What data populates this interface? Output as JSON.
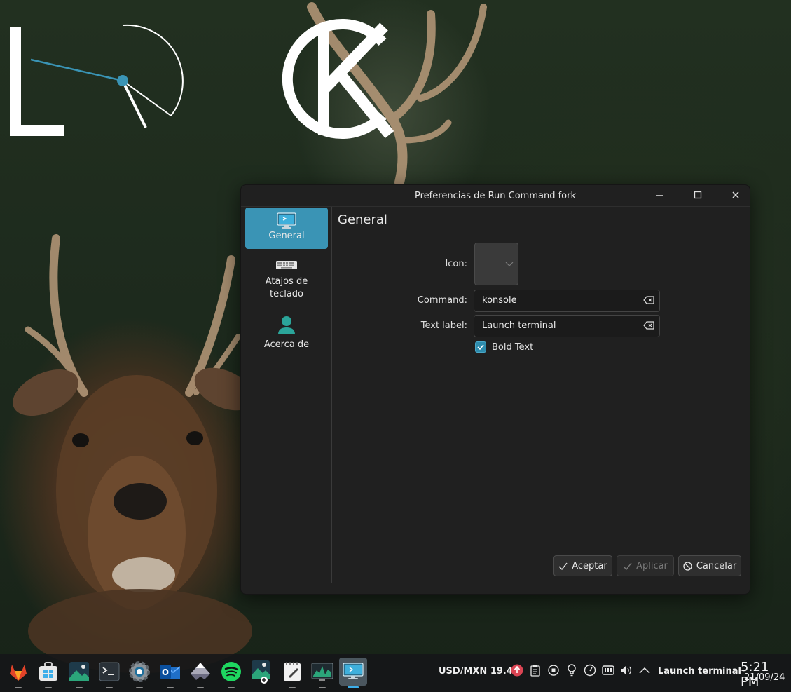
{
  "wallpaper": {
    "widget_text": "LOCK"
  },
  "dialog": {
    "title": "Preferencias de Run Command fork",
    "sidebar": [
      {
        "label": "General",
        "icon": "monitor-icon",
        "active": true
      },
      {
        "label": "Atajos de teclado",
        "icon": "keyboard-icon",
        "active": false
      },
      {
        "label": "Acerca de",
        "icon": "user-icon",
        "active": false
      }
    ],
    "page_title": "General",
    "form": {
      "icon_label": "Icon:",
      "command_label": "Command:",
      "command_value": "konsole",
      "text_label_label": "Text label:",
      "text_label_value": "Launch terminal",
      "bold_text_label": "Bold Text",
      "bold_text_checked": true
    },
    "buttons": {
      "accept": "Aceptar",
      "apply": "Aplicar",
      "cancel": "Cancelar"
    }
  },
  "taskbar": {
    "apps": [
      "gitlab-icon",
      "store-icon",
      "image-viewer-icon",
      "terminal-icon",
      "settings-icon",
      "outlook-icon",
      "inkscape-icon",
      "spotify-icon",
      "image-add-icon",
      "notes-icon",
      "system-monitor-icon",
      "run-command-icon"
    ],
    "exchange_rate": "USD/MXN 19.41",
    "launcher_text": "Launch terminal",
    "clock_time": "5:21 PM",
    "clock_date": "21/09/24"
  },
  "colors": {
    "accent": "#3a94b5",
    "dialog_bg": "#202020"
  }
}
